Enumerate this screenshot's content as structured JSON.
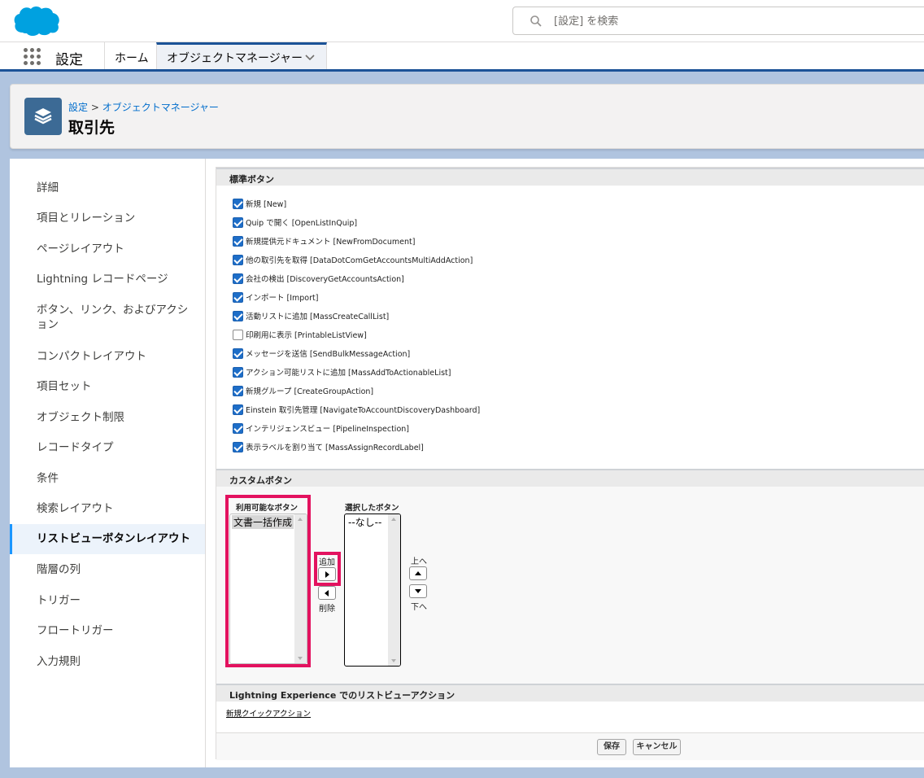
{
  "search": {
    "placeholder": "[設定] を検索"
  },
  "nav": {
    "app_name": "設定",
    "tabs": [
      {
        "label": "ホーム"
      },
      {
        "label": "オブジェクトマネージャー"
      }
    ]
  },
  "header": {
    "breadcrumb": [
      "設定",
      ">",
      "オブジェクトマネージャー"
    ],
    "title": "取引先"
  },
  "sidebar": {
    "items": [
      {
        "label": "詳細"
      },
      {
        "label": "項目とリレーション"
      },
      {
        "label": "ページレイアウト"
      },
      {
        "label": "Lightning レコードページ"
      },
      {
        "label": "ボタン、リンク、およびアクション"
      },
      {
        "label": "コンパクトレイアウト"
      },
      {
        "label": "項目セット"
      },
      {
        "label": "オブジェクト制限"
      },
      {
        "label": "レコードタイプ"
      },
      {
        "label": "条件"
      },
      {
        "label": "検索レイアウト"
      },
      {
        "label": "リストビューボタンレイアウト",
        "active": true
      },
      {
        "label": "階層の列"
      },
      {
        "label": "トリガー"
      },
      {
        "label": "フロートリガー"
      },
      {
        "label": "入力規則"
      }
    ]
  },
  "standard_buttons": {
    "title": "標準ボタン",
    "items": [
      {
        "label": "新規 [New]",
        "checked": true
      },
      {
        "label": "Quip で開く [OpenListInQuip]",
        "checked": true
      },
      {
        "label": "新規提供元ドキュメント [NewFromDocument]",
        "checked": true
      },
      {
        "label": "他の取引先を取得 [DataDotComGetAccountsMultiAddAction]",
        "checked": true
      },
      {
        "label": "会社の検出 [DiscoveryGetAccountsAction]",
        "checked": true
      },
      {
        "label": "インポート [Import]",
        "checked": true
      },
      {
        "label": "活動リストに追加 [MassCreateCallList]",
        "checked": true
      },
      {
        "label": "印刷用に表示 [PrintableListView]",
        "checked": false
      },
      {
        "label": "メッセージを送信 [SendBulkMessageAction]",
        "checked": true
      },
      {
        "label": "アクション可能リストに追加 [MassAddToActionableList]",
        "checked": true
      },
      {
        "label": "新規グループ [CreateGroupAction]",
        "checked": true
      },
      {
        "label": "Einstein 取引先管理 [NavigateToAccountDiscoveryDashboard]",
        "checked": true
      },
      {
        "label": "インテリジェンスビュー [PipelineInspection]",
        "checked": true
      },
      {
        "label": "表示ラベルを割り当て [MassAssignRecordLabel]",
        "checked": true
      }
    ]
  },
  "custom_buttons": {
    "title": "カスタムボタン",
    "available_title": "利用可能なボタン",
    "available_options": [
      "文書一括作成"
    ],
    "selected_title": "選択したボタン",
    "selected_options": [
      "--なし--"
    ],
    "add_label": "追加",
    "remove_label": "削除",
    "up_label": "上へ",
    "down_label": "下へ"
  },
  "lightning_section": {
    "title": "Lightning Experience でのリストビューアクション",
    "link": "新規クイックアクション"
  },
  "footer": {
    "save_label": "保存",
    "cancel_label": "キャンセル"
  },
  "colors": {
    "brand_blue": "#00a1e0",
    "highlight": "#e3125f",
    "checkbox_blue": "#1e6ec8",
    "header_icon": "#3c6a95"
  },
  "icons": {
    "logo": "salesforce-cloud-logo",
    "search": "search-icon",
    "app_launcher": "waffle-icon",
    "header": "layers-icon"
  }
}
